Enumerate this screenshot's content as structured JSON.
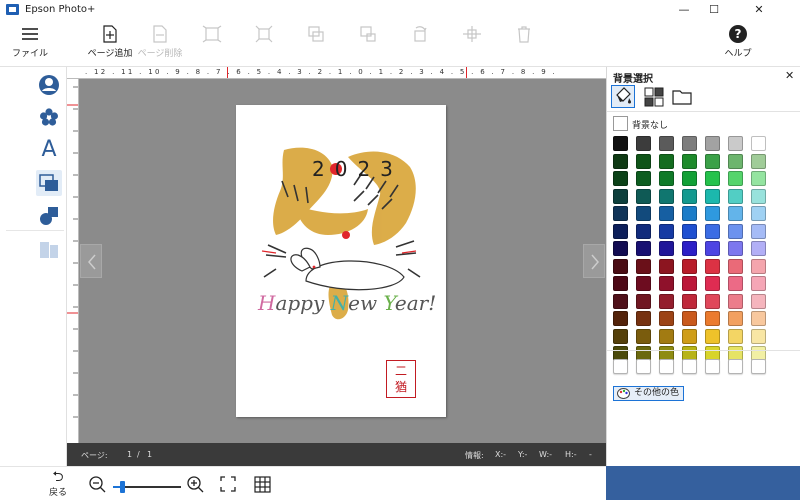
{
  "titlebar": {
    "app_title": "Epson Photo+",
    "minimize": "—",
    "maximize": "☐",
    "close": "✕"
  },
  "toolbar": {
    "file_label": "ファイル",
    "add_page_label": "ページ追加",
    "delete_page_label": "ページ削除",
    "help_label": "ヘルプ",
    "help_icon": "?"
  },
  "ruler": {
    "horizontal": ". 12 . 11 . 10 . 9 . 8 . 7 . 6 . 5 . 4 . 3 . 2 . 1 . 0 . 1 . 2 . 3 . 4 . 5 . 6 . 7 . 8 . 9 ."
  },
  "card": {
    "year": "2023",
    "greeting_h": "H",
    "greeting_appy": "appy ",
    "greeting_n": "N",
    "greeting_ew": "ew ",
    "greeting_y": "Y",
    "greeting_ear": "ear!",
    "seal_top": "二",
    "seal_bottom": "猶"
  },
  "status": {
    "page_label": "ページ:",
    "page_current": "1",
    "page_sep": "/",
    "page_total": "1",
    "info_label": "情報:",
    "x": "X:-",
    "y": "Y:-",
    "w": "W:-",
    "h": "H:-",
    "dash": "-"
  },
  "bottom": {
    "back_label": "戻る",
    "back_icon": "⮌"
  },
  "panel": {
    "title": "背景選択",
    "close": "✕",
    "no_background": "背景なし",
    "other_colors": "その他の色",
    "colors": [
      [
        "#111111",
        "#3c3c3c",
        "#5b5b5b",
        "#7d7d7d",
        "#a2a2a2",
        "#cacaca",
        "#ffffff"
      ],
      [
        "#0f3a14",
        "#0f5418",
        "#146c1f",
        "#1d8a2b",
        "#3ba148",
        "#6db56e",
        "#a0cc98"
      ],
      [
        "#0c4218",
        "#0d5d20",
        "#0f7a28",
        "#12a036",
        "#25c24c",
        "#55d46c",
        "#94e4a0"
      ],
      [
        "#0d3f3c",
        "#0f5a55",
        "#10766f",
        "#13998f",
        "#1cb8ad",
        "#52cec4",
        "#98e2dc"
      ],
      [
        "#103458",
        "#124a7c",
        "#165fa2",
        "#1b7cc8",
        "#2f99df",
        "#63b4ea",
        "#9fd1f3"
      ],
      [
        "#0d1f5a",
        "#112b7c",
        "#163aa3",
        "#1e4fd0",
        "#3b6ce4",
        "#6c92ee",
        "#a5bbf6"
      ],
      [
        "#120c52",
        "#181072",
        "#201699",
        "#2b1ec6",
        "#4d44e3",
        "#7d77ee",
        "#b2aff6"
      ],
      [
        "#4a0c14",
        "#6a1019",
        "#8c1520",
        "#b81c2a",
        "#dc3244",
        "#ea6a78",
        "#f4a5ad"
      ],
      [
        "#4d0816",
        "#6d0c20",
        "#8f112b",
        "#bb1739",
        "#df2c52",
        "#ec6a86",
        "#f5a6b6"
      ],
      [
        "#50111a",
        "#701722",
        "#941e2d",
        "#bf283a",
        "#e0475a",
        "#ec7d8b",
        "#f5b5bd"
      ],
      [
        "#53230a",
        "#763210",
        "#9c4315",
        "#c9591c",
        "#eb7b2e",
        "#f2a060",
        "#f8c89e"
      ],
      [
        "#55400a",
        "#7a5c0d",
        "#a27b12",
        "#cf9d17",
        "#eec22a",
        "#f3d564",
        "#f8e6a4"
      ],
      [
        "#4b4a0a",
        "#6b690e",
        "#8e8b12",
        "#b7b317",
        "#d8d42a",
        "#e6e364",
        "#f2f0a4"
      ]
    ]
  }
}
